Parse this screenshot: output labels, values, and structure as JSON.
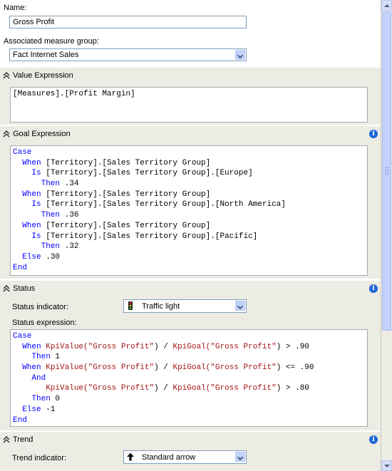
{
  "form": {
    "name_label": "Name:",
    "name_value": "Gross Profit",
    "measure_group_label": "Associated measure group:",
    "measure_group_value": "Fact Internet Sales"
  },
  "sections": {
    "value_expression": {
      "title": "Value Expression"
    },
    "goal_expression": {
      "title": "Goal Expression"
    },
    "status": {
      "title": "Status"
    },
    "trend": {
      "title": "Trend"
    }
  },
  "value_expression_code": [
    [
      {
        "t": "[Measures].[Profit Margin]",
        "c": "pl"
      }
    ]
  ],
  "goal_expression_code": [
    [
      {
        "t": "Case",
        "c": "kw"
      }
    ],
    [
      {
        "t": "  When ",
        "c": "kw"
      },
      {
        "t": "[Territory].[Sales Territory Group]",
        "c": "pl"
      }
    ],
    [
      {
        "t": "    Is ",
        "c": "kw"
      },
      {
        "t": "[Territory].[Sales Territory Group].[Europe]",
        "c": "pl"
      }
    ],
    [
      {
        "t": "      Then ",
        "c": "kw"
      },
      {
        "t": ".34",
        "c": "pl"
      }
    ],
    [
      {
        "t": "  When ",
        "c": "kw"
      },
      {
        "t": "[Territory].[Sales Territory Group]",
        "c": "pl"
      }
    ],
    [
      {
        "t": "    Is ",
        "c": "kw"
      },
      {
        "t": "[Territory].[Sales Territory Group].[North America]",
        "c": "pl"
      }
    ],
    [
      {
        "t": "      Then ",
        "c": "kw"
      },
      {
        "t": ".36",
        "c": "pl"
      }
    ],
    [
      {
        "t": "  When ",
        "c": "kw"
      },
      {
        "t": "[Territory].[Sales Territory Group]",
        "c": "pl"
      }
    ],
    [
      {
        "t": "    Is ",
        "c": "kw"
      },
      {
        "t": "[Territory].[Sales Territory Group].[Pacific]",
        "c": "pl"
      }
    ],
    [
      {
        "t": "      Then ",
        "c": "kw"
      },
      {
        "t": ".32",
        "c": "pl"
      }
    ],
    [
      {
        "t": "  Else ",
        "c": "kw"
      },
      {
        "t": ".30",
        "c": "pl"
      }
    ],
    [
      {
        "t": "End",
        "c": "kw"
      }
    ]
  ],
  "status": {
    "indicator_label": "Status indicator:",
    "indicator_value": "Traffic light",
    "indicator_icon": "traffic-light-icon",
    "expression_label": "Status expression:"
  },
  "status_expression_code": [
    [
      {
        "t": "Case",
        "c": "kw"
      }
    ],
    [
      {
        "t": "  When ",
        "c": "kw"
      },
      {
        "t": "KpiValue(",
        "c": "str"
      },
      {
        "t": "\"Gross Profit\"",
        "c": "str"
      },
      {
        "t": ") / ",
        "c": "pl"
      },
      {
        "t": "KpiGoal(",
        "c": "str"
      },
      {
        "t": "\"Gross Profit\"",
        "c": "str"
      },
      {
        "t": ") > .90",
        "c": "pl"
      }
    ],
    [
      {
        "t": "    Then ",
        "c": "kw"
      },
      {
        "t": "1",
        "c": "pl"
      }
    ],
    [
      {
        "t": "  When ",
        "c": "kw"
      },
      {
        "t": "KpiValue(",
        "c": "str"
      },
      {
        "t": "\"Gross Profit\"",
        "c": "str"
      },
      {
        "t": ") / ",
        "c": "pl"
      },
      {
        "t": "KpiGoal(",
        "c": "str"
      },
      {
        "t": "\"Gross Profit\"",
        "c": "str"
      },
      {
        "t": ") <= .90",
        "c": "pl"
      }
    ],
    [
      {
        "t": "    And",
        "c": "kw"
      }
    ],
    [
      {
        "t": "       KpiValue(",
        "c": "str"
      },
      {
        "t": "\"Gross Profit\"",
        "c": "str"
      },
      {
        "t": ") / ",
        "c": "pl"
      },
      {
        "t": "KpiGoal(",
        "c": "str"
      },
      {
        "t": "\"Gross Profit\"",
        "c": "str"
      },
      {
        "t": ") > .80",
        "c": "pl"
      }
    ],
    [
      {
        "t": "    Then ",
        "c": "kw"
      },
      {
        "t": "0",
        "c": "pl"
      }
    ],
    [
      {
        "t": "  Else ",
        "c": "kw"
      },
      {
        "t": "-1",
        "c": "pl"
      }
    ],
    [
      {
        "t": "End",
        "c": "kw"
      }
    ]
  ],
  "trend": {
    "indicator_label": "Trend indicator:",
    "indicator_value": "Standard arrow",
    "indicator_icon": "up-arrow-icon"
  },
  "colors": {
    "keyword": "#0000ff",
    "string": "#a31515",
    "section_bg": "#ecebe4",
    "input_border": "#7f9db9"
  }
}
